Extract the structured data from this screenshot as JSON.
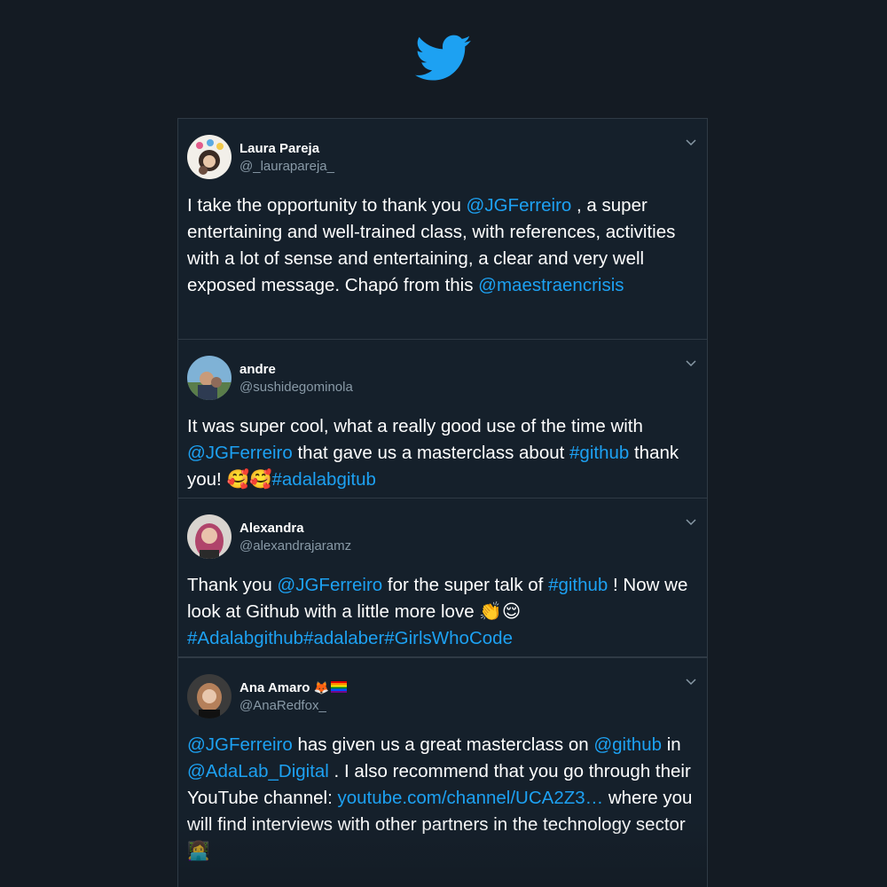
{
  "brand": {
    "icon": "twitter-bird-icon",
    "color": "#1da1f2"
  },
  "tweets": [
    {
      "name": "Laura Pareja",
      "handle": "@_laurapareja_",
      "segments": [
        {
          "t": "I take the opportunity to thank you "
        },
        {
          "t": "@JGFerreiro",
          "link": true
        },
        {
          "t": " , a super entertaining and well-trained class, with references, activities with a lot of sense and entertaining, a clear and very well exposed message. Chapó from this "
        },
        {
          "t": "@maestraencrisis",
          "link": true
        }
      ]
    },
    {
      "name": "andre",
      "handle": "@sushidegominola",
      "segments": [
        {
          "t": "It was super cool, what a really good use of the time with "
        },
        {
          "t": "@JGFerreiro",
          "link": true
        },
        {
          "t": " that gave us a masterclass about "
        },
        {
          "t": "#github",
          "link": true
        },
        {
          "t": " thank you! 🥰🥰"
        },
        {
          "t": "#adalabgitub",
          "link": true
        }
      ]
    },
    {
      "name": "Alexandra",
      "handle": "@alexandrajaramz",
      "segments": [
        {
          "t": "Thank you "
        },
        {
          "t": "@JGFerreiro",
          "link": true
        },
        {
          "t": " for the super talk of "
        },
        {
          "t": "#github",
          "link": true
        },
        {
          "t": " ! Now we look at Github with a little more love 👏😌 "
        },
        {
          "t": "#Adalabgithub#adalaber#GirlsWhoCode",
          "link": true
        }
      ]
    },
    {
      "name": "Ana Amaro",
      "name_emoji": "🦊",
      "handle": "@AnaRedfox_",
      "segments": [
        {
          "t": "@JGFerreiro",
          "link": true
        },
        {
          "t": " has given us a great masterclass on "
        },
        {
          "t": "@github",
          "link": true
        },
        {
          "t": " in "
        },
        {
          "t": "@AdaLab_Digital",
          "link": true
        },
        {
          "t": " . I also recommend that you go through their YouTube channel: "
        },
        {
          "t": "youtube.com/channel/UCA2Z3…",
          "link": true
        },
        {
          "t": " where you will find interviews with other partners in the technology sector 👩‍💻"
        }
      ]
    }
  ]
}
